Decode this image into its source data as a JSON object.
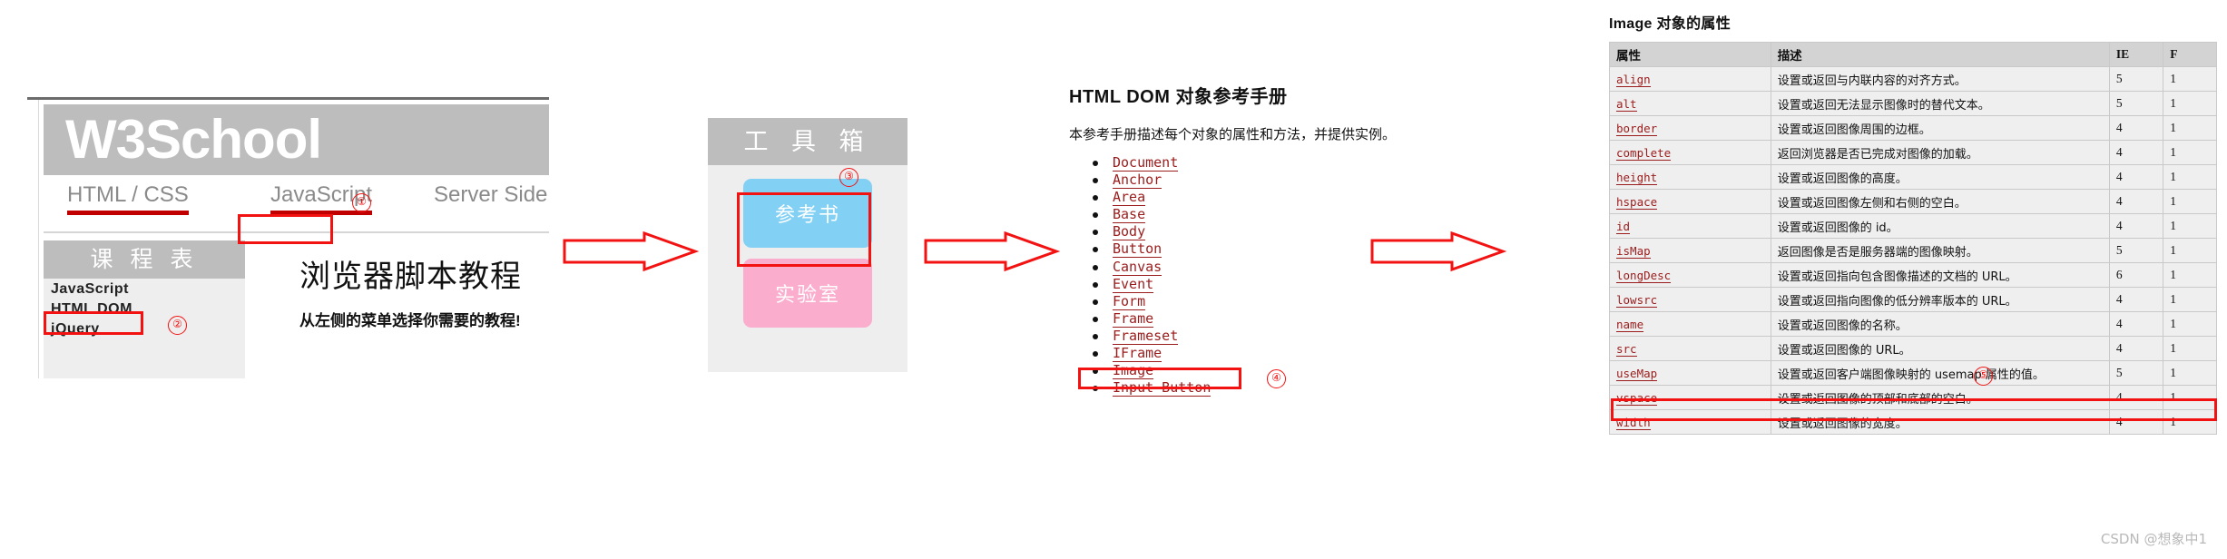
{
  "w3school": {
    "logo": "W3School",
    "tabs": [
      {
        "id": "htmlcss",
        "label": "HTML / CSS"
      },
      {
        "id": "javascript",
        "label": "JavaScript"
      },
      {
        "id": "serverside",
        "label": "Server Side"
      }
    ],
    "course_box": {
      "header": "课 程 表",
      "items": [
        "JavaScript",
        "HTML DOM",
        "jQuery"
      ]
    },
    "tutorial": {
      "title": "浏览器脚本教程",
      "subtitle": "从左侧的菜单选择你需要的教程!"
    }
  },
  "toolbox": {
    "header": "工 具 箱",
    "buttons": [
      {
        "id": "reference",
        "label": "参考书",
        "color": "#83d0f5"
      },
      {
        "id": "lab",
        "label": "实验室",
        "color": "#fbadce"
      }
    ]
  },
  "dom_reference": {
    "title": "HTML DOM 对象参考手册",
    "description": "本参考手册描述每个对象的属性和方法，并提供实例。",
    "items": [
      "Document",
      "Anchor",
      "Area",
      "Base",
      "Body",
      "Button",
      "Canvas",
      "Event",
      "Form",
      "Frame",
      "Frameset",
      "IFrame",
      "Image",
      "Input Button"
    ]
  },
  "image_table": {
    "title": "Image 对象的属性",
    "columns": [
      "属性",
      "描述",
      "IE",
      "F"
    ],
    "rows": [
      {
        "prop": "align",
        "desc": "设置或返回与内联内容的对齐方式。",
        "ie": "5",
        "f": "1"
      },
      {
        "prop": "alt",
        "desc": "设置或返回无法显示图像时的替代文本。",
        "ie": "5",
        "f": "1"
      },
      {
        "prop": "border",
        "desc": "设置或返回图像周围的边框。",
        "ie": "4",
        "f": "1"
      },
      {
        "prop": "complete",
        "desc": "返回浏览器是否已完成对图像的加载。",
        "ie": "4",
        "f": "1"
      },
      {
        "prop": "height",
        "desc": "设置或返回图像的高度。",
        "ie": "4",
        "f": "1"
      },
      {
        "prop": "hspace",
        "desc": "设置或返回图像左侧和右侧的空白。",
        "ie": "4",
        "f": "1"
      },
      {
        "prop": "id",
        "desc": "设置或返回图像的 id。",
        "ie": "4",
        "f": "1"
      },
      {
        "prop": "isMap",
        "desc": "返回图像是否是服务器端的图像映射。",
        "ie": "5",
        "f": "1"
      },
      {
        "prop": "longDesc",
        "desc": "设置或返回指向包含图像描述的文档的 URL。",
        "ie": "6",
        "f": "1"
      },
      {
        "prop": "lowsrc",
        "desc": "设置或返回指向图像的低分辨率版本的 URL。",
        "ie": "4",
        "f": "1"
      },
      {
        "prop": "name",
        "desc": "设置或返回图像的名称。",
        "ie": "4",
        "f": "1"
      },
      {
        "prop": "src",
        "desc": "设置或返回图像的 URL。",
        "ie": "4",
        "f": "1"
      },
      {
        "prop": "useMap",
        "desc": "设置或返回客户端图像映射的 usemap 属性的值。",
        "ie": "5",
        "f": "1"
      },
      {
        "prop": "vspace",
        "desc": "设置或返回图像的顶部和底部的空白。",
        "ie": "4",
        "f": "1"
      },
      {
        "prop": "width",
        "desc": "设置或返回图像的宽度。",
        "ie": "4",
        "f": "1"
      }
    ]
  },
  "annotations": {
    "markers": [
      "①",
      "②",
      "③",
      "④",
      "⑤"
    ],
    "highlight_color": "#f31212"
  },
  "watermark": "CSDN @想象中1"
}
